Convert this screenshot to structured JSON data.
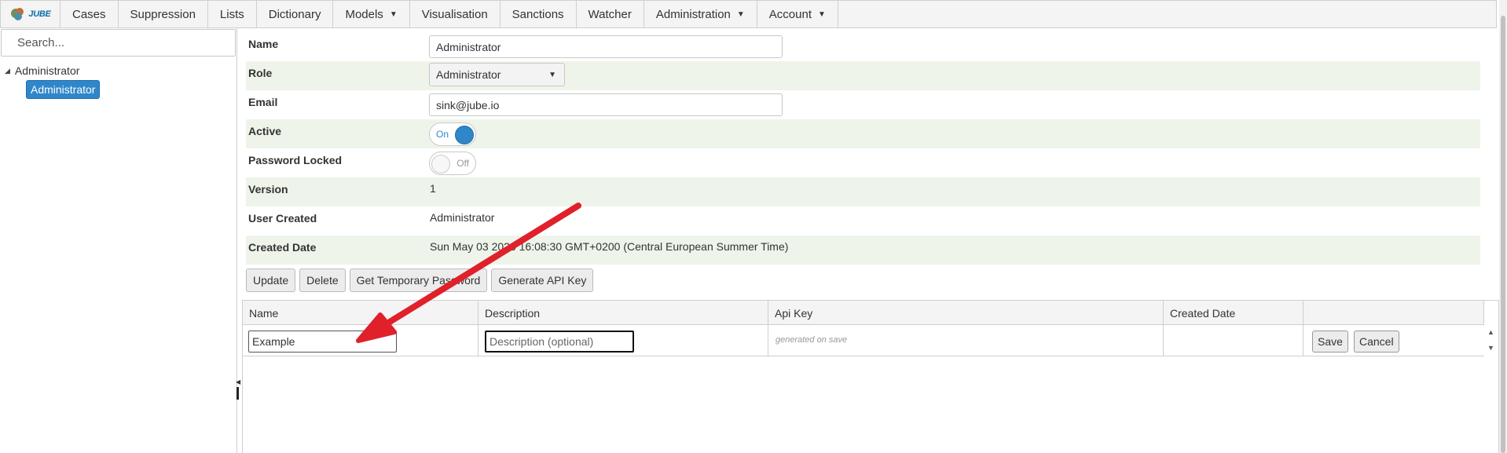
{
  "logo": {
    "text": "JUBE"
  },
  "nav": {
    "items": [
      {
        "label": "Cases",
        "dropdown": false
      },
      {
        "label": "Suppression",
        "dropdown": false
      },
      {
        "label": "Lists",
        "dropdown": false
      },
      {
        "label": "Dictionary",
        "dropdown": false
      },
      {
        "label": "Models",
        "dropdown": true
      },
      {
        "label": "Visualisation",
        "dropdown": false
      },
      {
        "label": "Sanctions",
        "dropdown": false
      },
      {
        "label": "Watcher",
        "dropdown": false
      },
      {
        "label": "Administration",
        "dropdown": true
      },
      {
        "label": "Account",
        "dropdown": true
      }
    ]
  },
  "sidebar": {
    "search_placeholder": "Search...",
    "tree": {
      "root": "Administrator",
      "child": "Administrator"
    }
  },
  "form": {
    "name": {
      "label": "Name",
      "value": "Administrator"
    },
    "role": {
      "label": "Role",
      "value": "Administrator"
    },
    "email": {
      "label": "Email",
      "value": "sink@jube.io"
    },
    "active": {
      "label": "Active",
      "state": "On"
    },
    "password_locked": {
      "label": "Password Locked",
      "state": "Off"
    },
    "version": {
      "label": "Version",
      "value": "1"
    },
    "user_created": {
      "label": "User Created",
      "value": "Administrator"
    },
    "created_date": {
      "label": "Created Date",
      "value": "Sun May 03 2026 16:08:30 GMT+0200 (Central European Summer Time)"
    }
  },
  "buttons": {
    "update": "Update",
    "delete": "Delete",
    "temp_password": "Get Temporary Password",
    "api_key": "Generate API Key"
  },
  "grid": {
    "columns": [
      "Name",
      "Description",
      "Api Key",
      "Created Date"
    ],
    "row": {
      "name_value": "Example",
      "description_placeholder": "Description (optional)",
      "api_key_hint": "generated on save",
      "save_label": "Save",
      "cancel_label": "Cancel"
    }
  },
  "colors": {
    "accent": "#2f87c9",
    "alt_row": "#eef4ea",
    "annotation_arrow": "#e0202a"
  }
}
